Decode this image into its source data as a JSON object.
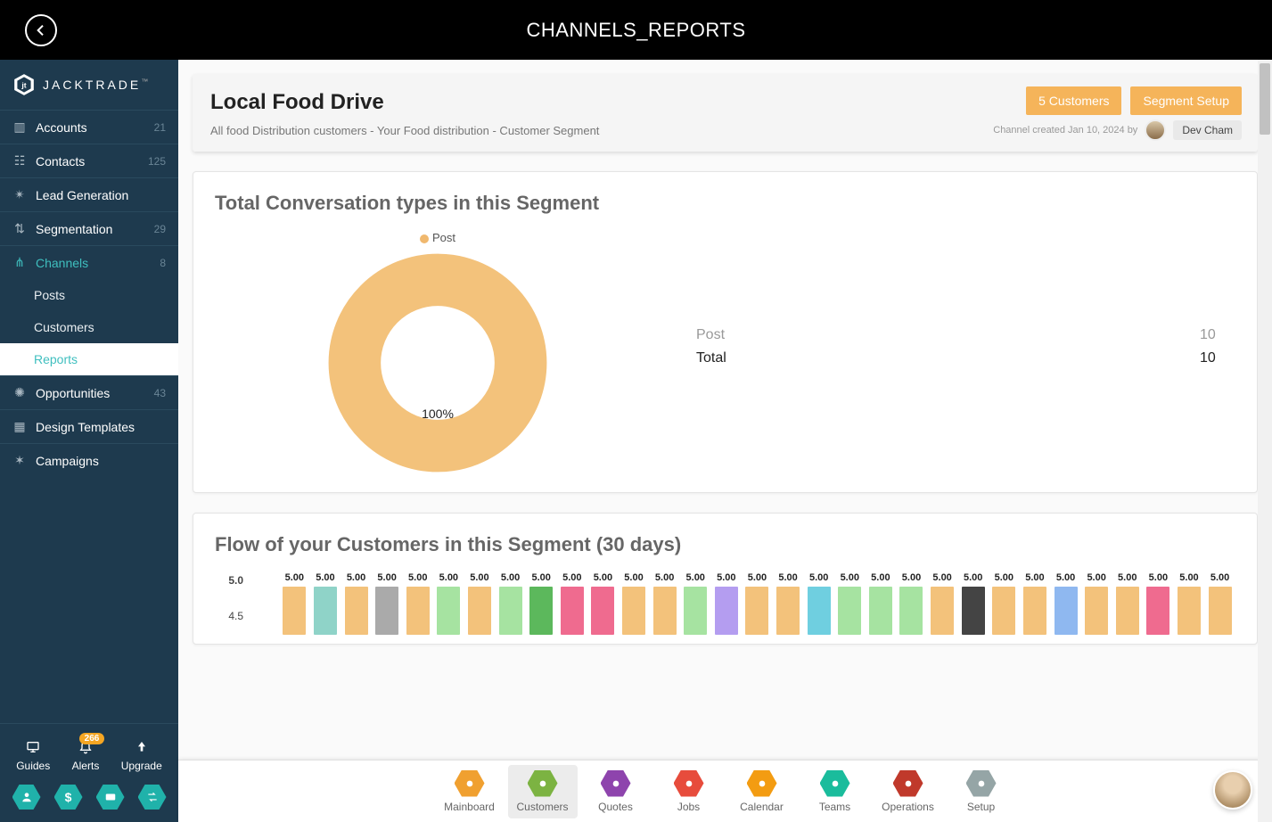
{
  "topbar": {
    "title": "CHANNELS_REPORTS"
  },
  "brand": {
    "name": "JACKTRADE",
    "tm": "™"
  },
  "sidebar": {
    "items": [
      {
        "label": "Accounts",
        "badge": "21"
      },
      {
        "label": "Contacts",
        "badge": "125"
      },
      {
        "label": "Lead Generation",
        "badge": ""
      },
      {
        "label": "Segmentation",
        "badge": "29"
      },
      {
        "label": "Channels",
        "badge": "8",
        "active": true
      },
      {
        "label": "Opportunities",
        "badge": "43"
      },
      {
        "label": "Design Templates",
        "badge": ""
      },
      {
        "label": "Campaigns",
        "badge": ""
      }
    ],
    "subitems": [
      {
        "label": "Posts"
      },
      {
        "label": "Customers"
      },
      {
        "label": "Reports",
        "active": true
      }
    ],
    "bottom_buttons": [
      {
        "label": "Guides"
      },
      {
        "label": "Alerts",
        "pill": "266"
      },
      {
        "label": "Upgrade"
      }
    ]
  },
  "page_header": {
    "title": "Local Food Drive",
    "subtitle": "All food Distribution customers - Your Food distribution - Customer Segment",
    "btn_customers": "5 Customers",
    "btn_setup": "Segment Setup",
    "created_prefix": "Channel created Jan 10, 2024 by",
    "author": "Dev Cham"
  },
  "donut_card": {
    "title": "Total Conversation types in this Segment",
    "legend": "Post",
    "center_pct": "100%",
    "rows": [
      {
        "label": "Post",
        "value": "10",
        "muted": true
      },
      {
        "label": "Total",
        "value": "10",
        "muted": false
      }
    ]
  },
  "bars_card": {
    "title": "Flow of your Customers in this Segment (30 days)"
  },
  "chart_data": [
    {
      "type": "pie",
      "title": "Total Conversation types in this Segment",
      "series": [
        {
          "name": "Post",
          "value": 10,
          "pct": 100,
          "color": "#f3c27b"
        }
      ],
      "total": 10
    },
    {
      "type": "bar",
      "title": "Flow of your Customers in this Segment (30 days)",
      "ylabel": "",
      "xlabel": "",
      "ylim": [
        4.5,
        5.0
      ],
      "yticks": [
        5.0,
        4.5
      ],
      "values": [
        5.0,
        5.0,
        5.0,
        5.0,
        5.0,
        5.0,
        5.0,
        5.0,
        5.0,
        5.0,
        5.0,
        5.0,
        5.0,
        5.0,
        5.0,
        5.0,
        5.0,
        5.0,
        5.0,
        5.0,
        5.0,
        5.0,
        5.0,
        5.0,
        5.0,
        5.0,
        5.0,
        5.0,
        5.0,
        5.0,
        5.0
      ],
      "colors": [
        "#f3c27b",
        "#8fd3c8",
        "#f3c27b",
        "#aaaaaa",
        "#f3c27b",
        "#a6e3a1",
        "#f3c27b",
        "#a6e3a1",
        "#5cb85c",
        "#ef6b8f",
        "#ef6b8f",
        "#f3c27b",
        "#f3c27b",
        "#a6e3a1",
        "#b49df0",
        "#f3c27b",
        "#f3c27b",
        "#6fcfe0",
        "#a6e3a1",
        "#a6e3a1",
        "#a6e3a1",
        "#f3c27b",
        "#444444",
        "#f3c27b",
        "#f3c27b",
        "#8fb8f0",
        "#f3c27b",
        "#f3c27b",
        "#ef6b8f",
        "#f3c27b",
        "#f3c27b"
      ]
    }
  ],
  "bottomnav": {
    "items": [
      {
        "label": "Mainboard",
        "color": "#f0a030"
      },
      {
        "label": "Customers",
        "color": "#7cb342",
        "active": true
      },
      {
        "label": "Quotes",
        "color": "#8e44ad"
      },
      {
        "label": "Jobs",
        "color": "#e74c3c"
      },
      {
        "label": "Calendar",
        "color": "#f39c12"
      },
      {
        "label": "Teams",
        "color": "#1abc9c"
      },
      {
        "label": "Operations",
        "color": "#c0392b"
      },
      {
        "label": "Setup",
        "color": "#95a5a6"
      }
    ]
  }
}
